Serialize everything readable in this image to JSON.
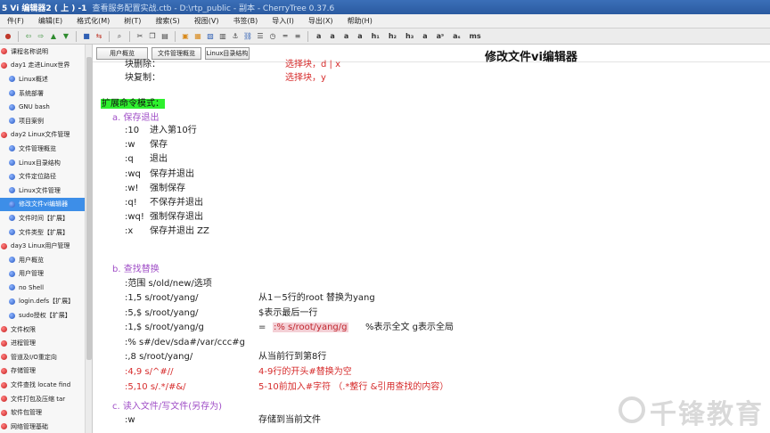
{
  "window": {
    "title_left": "5 Vi 编辑器2 ( 上 ) -1",
    "title_right": "查看服务配置实战.ctb - D:\\rtp_public - 副本 - CherryTree 0.37.6"
  },
  "menu": [
    "件(F)",
    "编辑(E)",
    "格式化(M)",
    "树(T)",
    "搜索(S)",
    "视图(V)",
    "书签(B)",
    "导入(I)",
    "导出(X)",
    "帮助(H)"
  ],
  "toolbar": {
    "text_buttons": [
      "a",
      "a",
      "a",
      "a",
      "h₁",
      "h₂",
      "h₃",
      "a",
      "aˢ",
      "aₛ",
      "ms"
    ]
  },
  "sidebar": {
    "nodes": [
      {
        "label": "课程名称说明",
        "level": 0,
        "color": "red"
      },
      {
        "label": "day1 走进Linux世界",
        "level": 0,
        "color": "red"
      },
      {
        "label": "Linux概述",
        "level": 1,
        "color": "blue"
      },
      {
        "label": "系统部署",
        "level": 1,
        "color": "blue"
      },
      {
        "label": "GNU bash",
        "level": 1,
        "color": "blue"
      },
      {
        "label": "项目案例",
        "level": 1,
        "color": "blue"
      },
      {
        "label": "day2 Linux文件管理",
        "level": 0,
        "color": "red"
      },
      {
        "label": "文件管理概览",
        "level": 1,
        "color": "blue"
      },
      {
        "label": "Linux目录结构",
        "level": 1,
        "color": "blue"
      },
      {
        "label": "文件定位路径",
        "level": 1,
        "color": "blue"
      },
      {
        "label": "Linux文件管理",
        "level": 1,
        "color": "blue"
      },
      {
        "label": "修改文件vi编辑器",
        "level": 1,
        "color": "blue",
        "selected": true
      },
      {
        "label": "文件时间【扩展】",
        "level": 1,
        "color": "blue"
      },
      {
        "label": "文件类型【扩展】",
        "level": 1,
        "color": "blue"
      },
      {
        "label": "day3 Linux用户管理",
        "level": 0,
        "color": "red"
      },
      {
        "label": "用户概览",
        "level": 1,
        "color": "blue"
      },
      {
        "label": "用户管理",
        "level": 1,
        "color": "blue"
      },
      {
        "label": "no Shell",
        "level": 1,
        "color": "blue"
      },
      {
        "label": "login.defs【扩展】",
        "level": 1,
        "color": "blue"
      },
      {
        "label": "sudo授权【扩展】",
        "level": 1,
        "color": "blue"
      },
      {
        "label": "文件权限",
        "level": 0,
        "color": "red"
      },
      {
        "label": "进程管理",
        "level": 0,
        "color": "red"
      },
      {
        "label": "管道及I/O重定向",
        "level": 0,
        "color": "red"
      },
      {
        "label": "存储管理",
        "level": 0,
        "color": "red"
      },
      {
        "label": "文件查找 locate find",
        "level": 0,
        "color": "red"
      },
      {
        "label": "文件打包及压缩 tar",
        "level": 0,
        "color": "red"
      },
      {
        "label": "软件包管理",
        "level": 0,
        "color": "red"
      },
      {
        "label": "网络管理基础",
        "level": 0,
        "color": "red"
      }
    ]
  },
  "linkbar": {
    "buttons": [
      "用户概览",
      "文件管理概览",
      "Linux目录结构"
    ],
    "node_title": "修改文件vi编辑器"
  },
  "doc": {
    "l_top1": "块删除：",
    "l_top1b": "选择块，d | x",
    "l_top2": "块复制：",
    "l_top2b": "选择块，y",
    "ext_heading": "扩展命令模式：",
    "save_heading": "a. 保存退出",
    "save_cmds": [
      {
        "cmd": ":10",
        "desc": "进入第10行"
      },
      {
        "cmd": ":w",
        "desc": "保存"
      },
      {
        "cmd": ":q",
        "desc": "退出"
      },
      {
        "cmd": ":wq",
        "desc": "保存并退出"
      },
      {
        "cmd": ":w!",
        "desc": "强制保存"
      },
      {
        "cmd": ":q!",
        "desc": "不保存并退出"
      },
      {
        "cmd": ":wq!",
        "desc": "强制保存退出"
      },
      {
        "cmd": ":x",
        "desc": "保存并退出   ZZ"
      }
    ],
    "find_heading": "b. 查找替换",
    "find_range": ":范围 s/old/new/选项",
    "find_rows": [
      {
        "cmd": ":1,5 s/root/yang/",
        "desc": "从1－5行的root 替换为yang"
      },
      {
        "cmd": ":5,$ s/root/yang/",
        "desc": "$表示最后一行"
      },
      {
        "cmd": ":1,$ s/root/yang/g",
        "eq": "=",
        "hl": ":% s/root/yang/g",
        "desc": "%表示全文  g表示全局"
      },
      {
        "cmd": ":% s#/dev/sda#/var/ccc#g",
        "desc": ""
      },
      {
        "cmd": ":,8 s/root/yang/",
        "desc": "从当前行到第8行"
      },
      {
        "cmd": ":4,9 s/^#//",
        "desc": "4-9行的开头#替换为空"
      },
      {
        "cmd": ":5,10 s/.*/#&/",
        "desc": "5-10前加入#字符  （.*整行   &引用查找的内容）"
      }
    ],
    "read_heading": "c. 读入文件/写文件(另存为)",
    "read_rows": [
      {
        "cmd": ":w",
        "desc": "存储到当前文件"
      }
    ]
  },
  "watermark": "千锋教育"
}
